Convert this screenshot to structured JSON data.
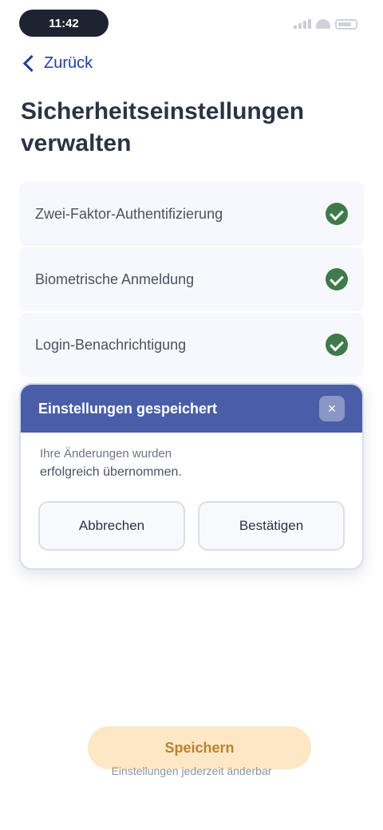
{
  "status_bar": {
    "time": "11:42"
  },
  "nav": {
    "back_label": "Zurück"
  },
  "page": {
    "title": "Sicherheitseinstellungen verwalten"
  },
  "options": [
    {
      "label": "Zwei-Faktor-Authentifizierung",
      "checked": true
    },
    {
      "label": "Biometrische Anmeldung",
      "checked": true
    },
    {
      "label": "Login-Benachrichtigung",
      "checked": true
    }
  ],
  "dialog": {
    "title": "Einstellungen gespeichert",
    "close_label": "×",
    "line1": "Ihre Änderungen wurden",
    "line2": "erfolgreich übernommen.",
    "buttons": [
      "Abbrechen",
      "Bestätigen"
    ]
  },
  "footer": {
    "cta_label": "Speichern",
    "footnote": "Einstellungen jederzeit änderbar"
  },
  "colors": {
    "primary": "#4a5ea8",
    "success": "#3f7a4a",
    "accent": "#fde7c4"
  }
}
